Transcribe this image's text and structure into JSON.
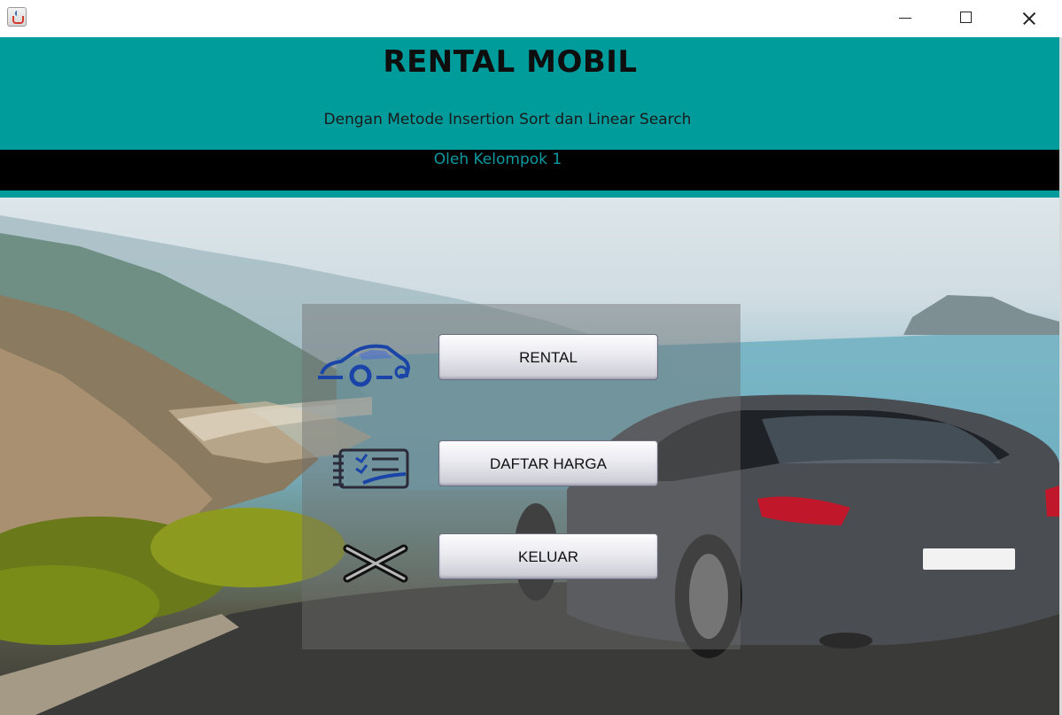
{
  "window": {
    "app_icon": "java-cup-icon",
    "controls": [
      "minimize-icon",
      "maximize-icon",
      "close-icon"
    ]
  },
  "header": {
    "title": "RENTAL MOBIL",
    "subtitle": "Dengan Metode Insertion Sort dan Linear Search",
    "group": "Oleh Kelompok 1",
    "colors": {
      "teal": "#009c9c",
      "band": "#000000",
      "group_text": "#0c9aa2"
    }
  },
  "menu": {
    "items": [
      {
        "label": "RENTAL",
        "icon": "car-icon"
      },
      {
        "label": "DAFTAR HARGA",
        "icon": "price-list-icon"
      },
      {
        "label": "KELUAR",
        "icon": "exit-x-icon"
      }
    ]
  }
}
